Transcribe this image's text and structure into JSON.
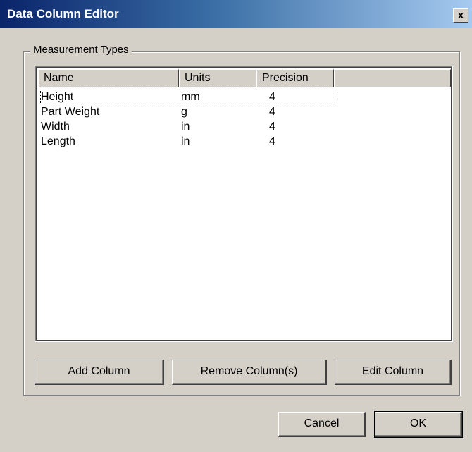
{
  "window": {
    "title": "Data Column Editor",
    "close_glyph": "x"
  },
  "group": {
    "label": "Measurement Types"
  },
  "list": {
    "columns": [
      "Name",
      "Units",
      "Precision"
    ],
    "rows": [
      [
        "Height",
        "mm",
        "4"
      ],
      [
        "Part Weight",
        "g",
        "4"
      ],
      [
        "Width",
        "in",
        "4"
      ],
      [
        "Length",
        "in",
        "4"
      ]
    ]
  },
  "buttons": {
    "add": "Add Column",
    "remove": "Remove Column(s)",
    "edit": "Edit Column",
    "cancel": "Cancel",
    "ok": "OK"
  },
  "colors": {
    "face": "#d4d0c8",
    "title_start": "#0a246a",
    "title_end": "#a6caf0"
  }
}
